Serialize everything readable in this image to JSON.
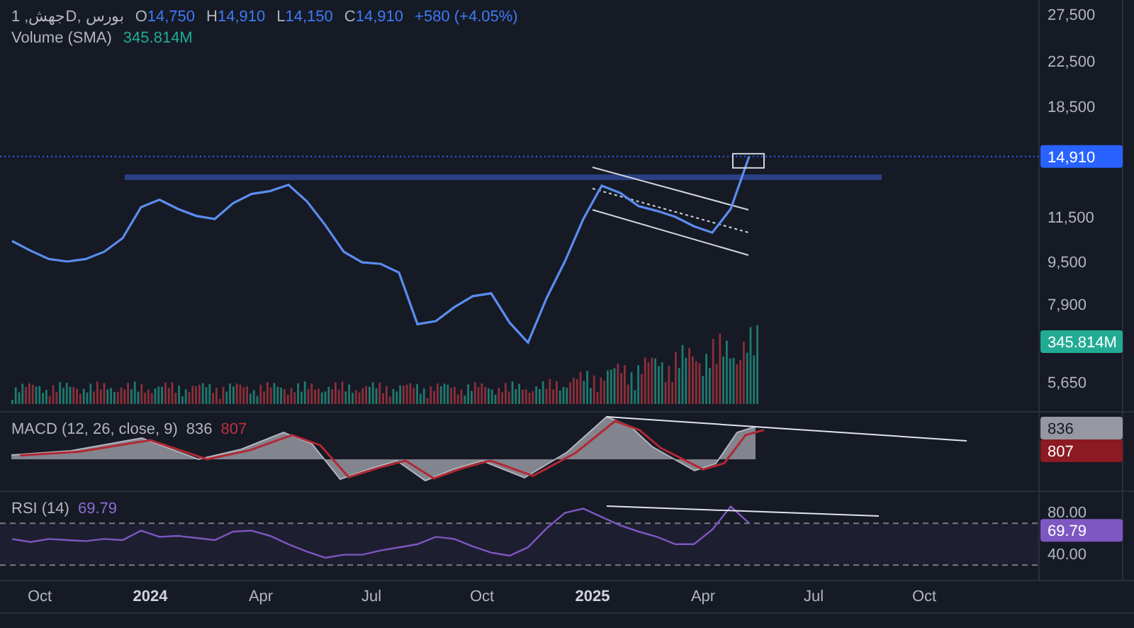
{
  "legend": {
    "symbol": "جهش, 1D, بورس",
    "ohlc": [
      {
        "key": "O",
        "value": "14,750"
      },
      {
        "key": "H",
        "value": "14,910"
      },
      {
        "key": "L",
        "value": "14,150"
      },
      {
        "key": "C",
        "value": "14,910"
      }
    ],
    "change": "+580 (+4.05%)",
    "volume_label": "Volume (SMA)",
    "volume_value": "345.814M"
  },
  "price_chart": {
    "axis_labels": [
      "27,500",
      "22,500",
      "18,500",
      "11,500",
      "9,500",
      "7,900",
      "5,650"
    ],
    "price_badge": "14,910",
    "volume_badge": "345.814M"
  },
  "macd": {
    "label": "MACD (12, 26, close, 9)",
    "macd_value": "836",
    "signal_value": "807",
    "macd_badge": "836",
    "signal_badge": "807"
  },
  "rsi": {
    "label": "RSI (14)",
    "value": "69.79",
    "badge": "69.79",
    "axis_labels": [
      "80.00",
      "40.00"
    ]
  },
  "time_axis": [
    {
      "label": "Oct",
      "kind": "month"
    },
    {
      "label": "2024",
      "kind": "year"
    },
    {
      "label": "Apr",
      "kind": "month"
    },
    {
      "label": "Jul",
      "kind": "month"
    },
    {
      "label": "Oct",
      "kind": "month"
    },
    {
      "label": "2025",
      "kind": "year"
    },
    {
      "label": "Apr",
      "kind": "month"
    },
    {
      "label": "Jul",
      "kind": "month"
    },
    {
      "label": "Oct",
      "kind": "month"
    }
  ]
}
